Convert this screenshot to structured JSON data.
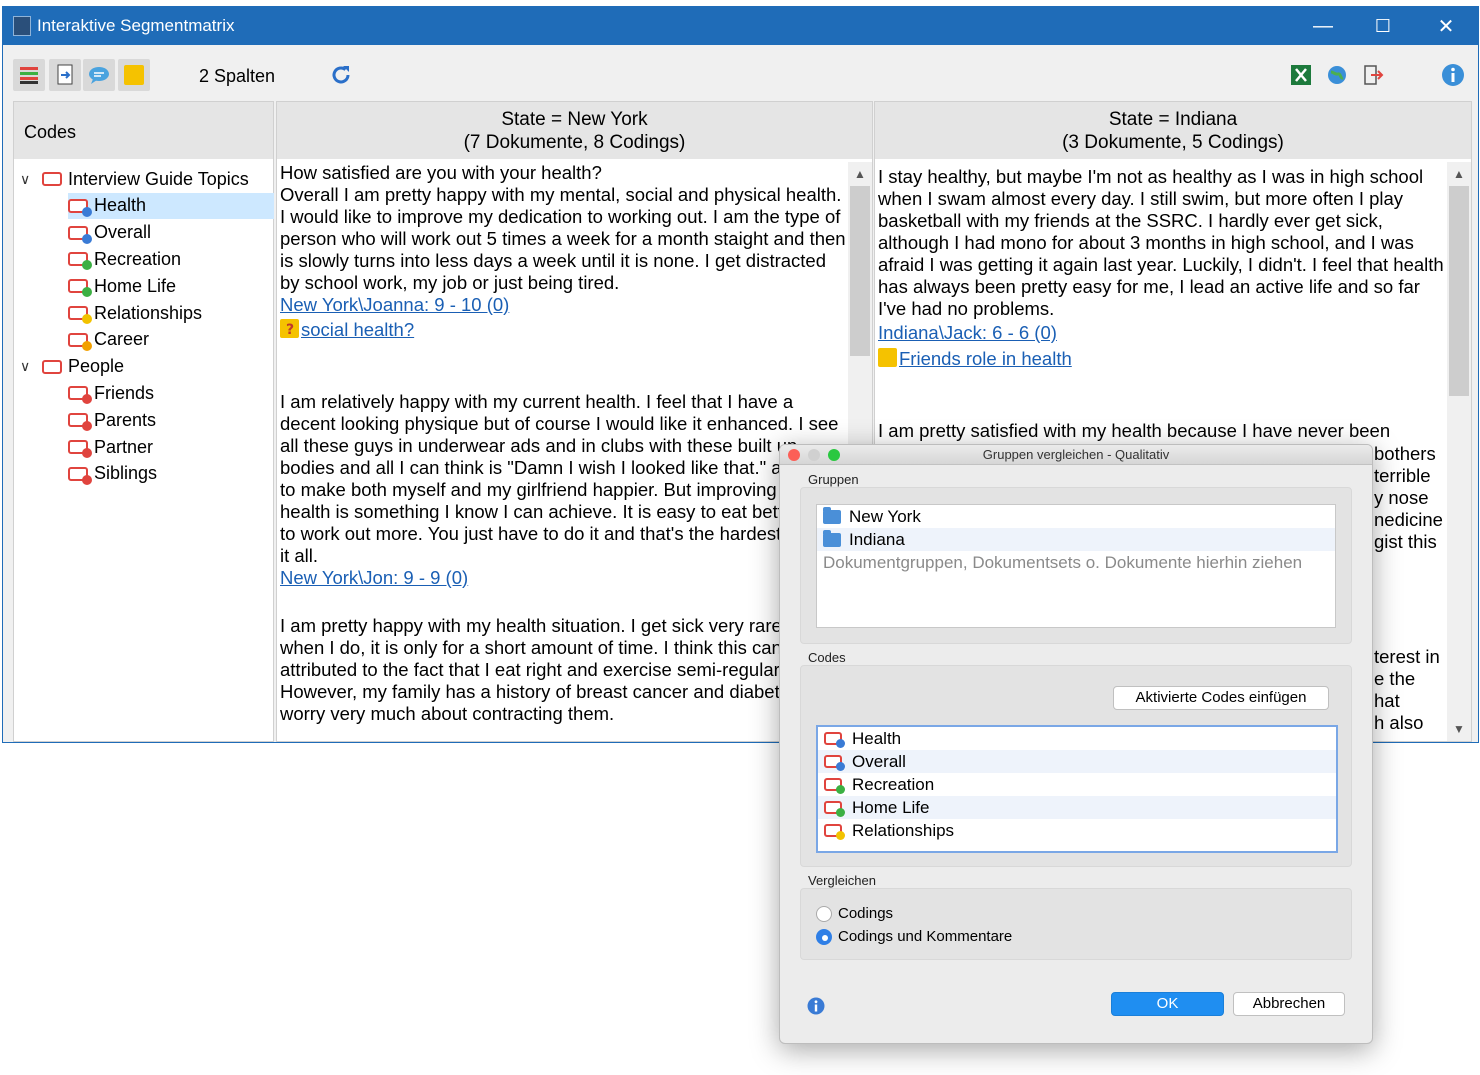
{
  "window": {
    "title": "Interaktive Segmentmatrix",
    "minimize": "—",
    "maximize": "☐",
    "close": "✕"
  },
  "toolbar": {
    "columns_label": "2 Spalten"
  },
  "codes_panel": {
    "header": "Codes",
    "items": [
      {
        "label": "Interview Guide Topics",
        "level": 0,
        "expanded": true
      },
      {
        "label": "Health",
        "level": 1,
        "selected": true,
        "dot": "#3a7bd5"
      },
      {
        "label": "Overall",
        "level": 1,
        "dot": "#3a7bd5"
      },
      {
        "label": "Recreation",
        "level": 1,
        "dot": "#3cb043"
      },
      {
        "label": "Home Life",
        "level": 1,
        "dot": "#3cb043"
      },
      {
        "label": "Relationships",
        "level": 1,
        "dot": "#f2c200"
      },
      {
        "label": "Career",
        "level": 1,
        "dot": "#f2a000"
      },
      {
        "label": "People",
        "level": 0,
        "expanded": true
      },
      {
        "label": "Friends",
        "level": 1,
        "dot": "#e0443e"
      },
      {
        "label": "Parents",
        "level": 1,
        "dot": "#e0443e"
      },
      {
        "label": "Partner",
        "level": 1,
        "dot": "#e0443e"
      },
      {
        "label": "Siblings",
        "level": 1,
        "dot": "#e0443e"
      }
    ]
  },
  "columns": [
    {
      "header1": "State = New York",
      "header2": "(7 Dokumente, 8 Codings)",
      "p1": "How satisfied are you with your health?",
      "p2": "Overall I am pretty happy with my mental, social and physical health.  I would like to improve my dedication to working out.  I am the type of person who will work out 5 times a week for a month staight and then is slowly turns into less days a week until it is none.  I get distracted by school work, my job or just being tired.",
      "link1": "New York\\Joanna: 9 - 10  (0)",
      "memo1": "social health?",
      "p3": "I am relatively happy with my current health.  I feel that I have a decent looking physique but of course I would like it enhanced.  I see all these guys in underwear ads and in clubs with these built up bodies and all I can think is \"Damn I wish I looked like that.\" anything to make both myself and my girlfriend happier.  But improving my health is something I know I can achieve.  It is easy to eat better and to work out more.  You just have to do it and that's the hardest part of it all.",
      "link2": "New York\\Jon: 9 - 9  (0)",
      "p4": "I am pretty happy with my health situation. I get sick very rarely and when I do, it is only for a short amount of time. I think this can be attributed to the fact that I eat right and exercise semi-regularly. However, my family has a history of breast cancer and diabetes so I worry very much about contracting them."
    },
    {
      "header1": "State = Indiana",
      "header2": "(3 Dokumente, 5 Codings)",
      "p1": "I stay healthy, but maybe I'm not as healthy as I was in high school when I swam almost every day.  I still swim, but more often I play basketball with my friends at the SSRC.  I hardly ever get sick, although I had mono for about 3 months in high school, and I was afraid I was getting it again last year.  Luckily, I didn't.  I feel that health has always been pretty easy for me, I lead an active life and so far I've had no problems.",
      "link1": "Indiana\\Jack: 6 - 6  (0)",
      "memo1": "Friends role in health",
      "p2": "I am pretty satisfied with my health because I have never been",
      "frag1": "bothers",
      "frag2": "terrible",
      "frag3": "y nose",
      "frag4": "nedicine",
      "frag5": "gist this",
      "frag6": "terest in",
      "frag7": "e the",
      "frag8": "hat",
      "frag9": "h also"
    }
  ],
  "dialog": {
    "title": "Gruppen vergleichen - Qualitativ",
    "groups_label": "Gruppen",
    "groups": [
      "New York",
      "Indiana"
    ],
    "groups_placeholder": "Dokumentgruppen, Dokumentsets o. Dokumente hierhin ziehen",
    "codes_label": "Codes",
    "insert_button": "Aktivierte Codes einfügen",
    "codes": [
      {
        "label": "Health",
        "dot": "#3a7bd5"
      },
      {
        "label": "Overall",
        "dot": "#3a7bd5"
      },
      {
        "label": "Recreation",
        "dot": "#3cb043"
      },
      {
        "label": "Home Life",
        "dot": "#3cb043"
      },
      {
        "label": "Relationships",
        "dot": "#f2c200"
      }
    ],
    "compare_label": "Vergleichen",
    "opt1": "Codings",
    "opt2": "Codings und Kommentare",
    "ok": "OK",
    "cancel": "Abbrechen"
  }
}
